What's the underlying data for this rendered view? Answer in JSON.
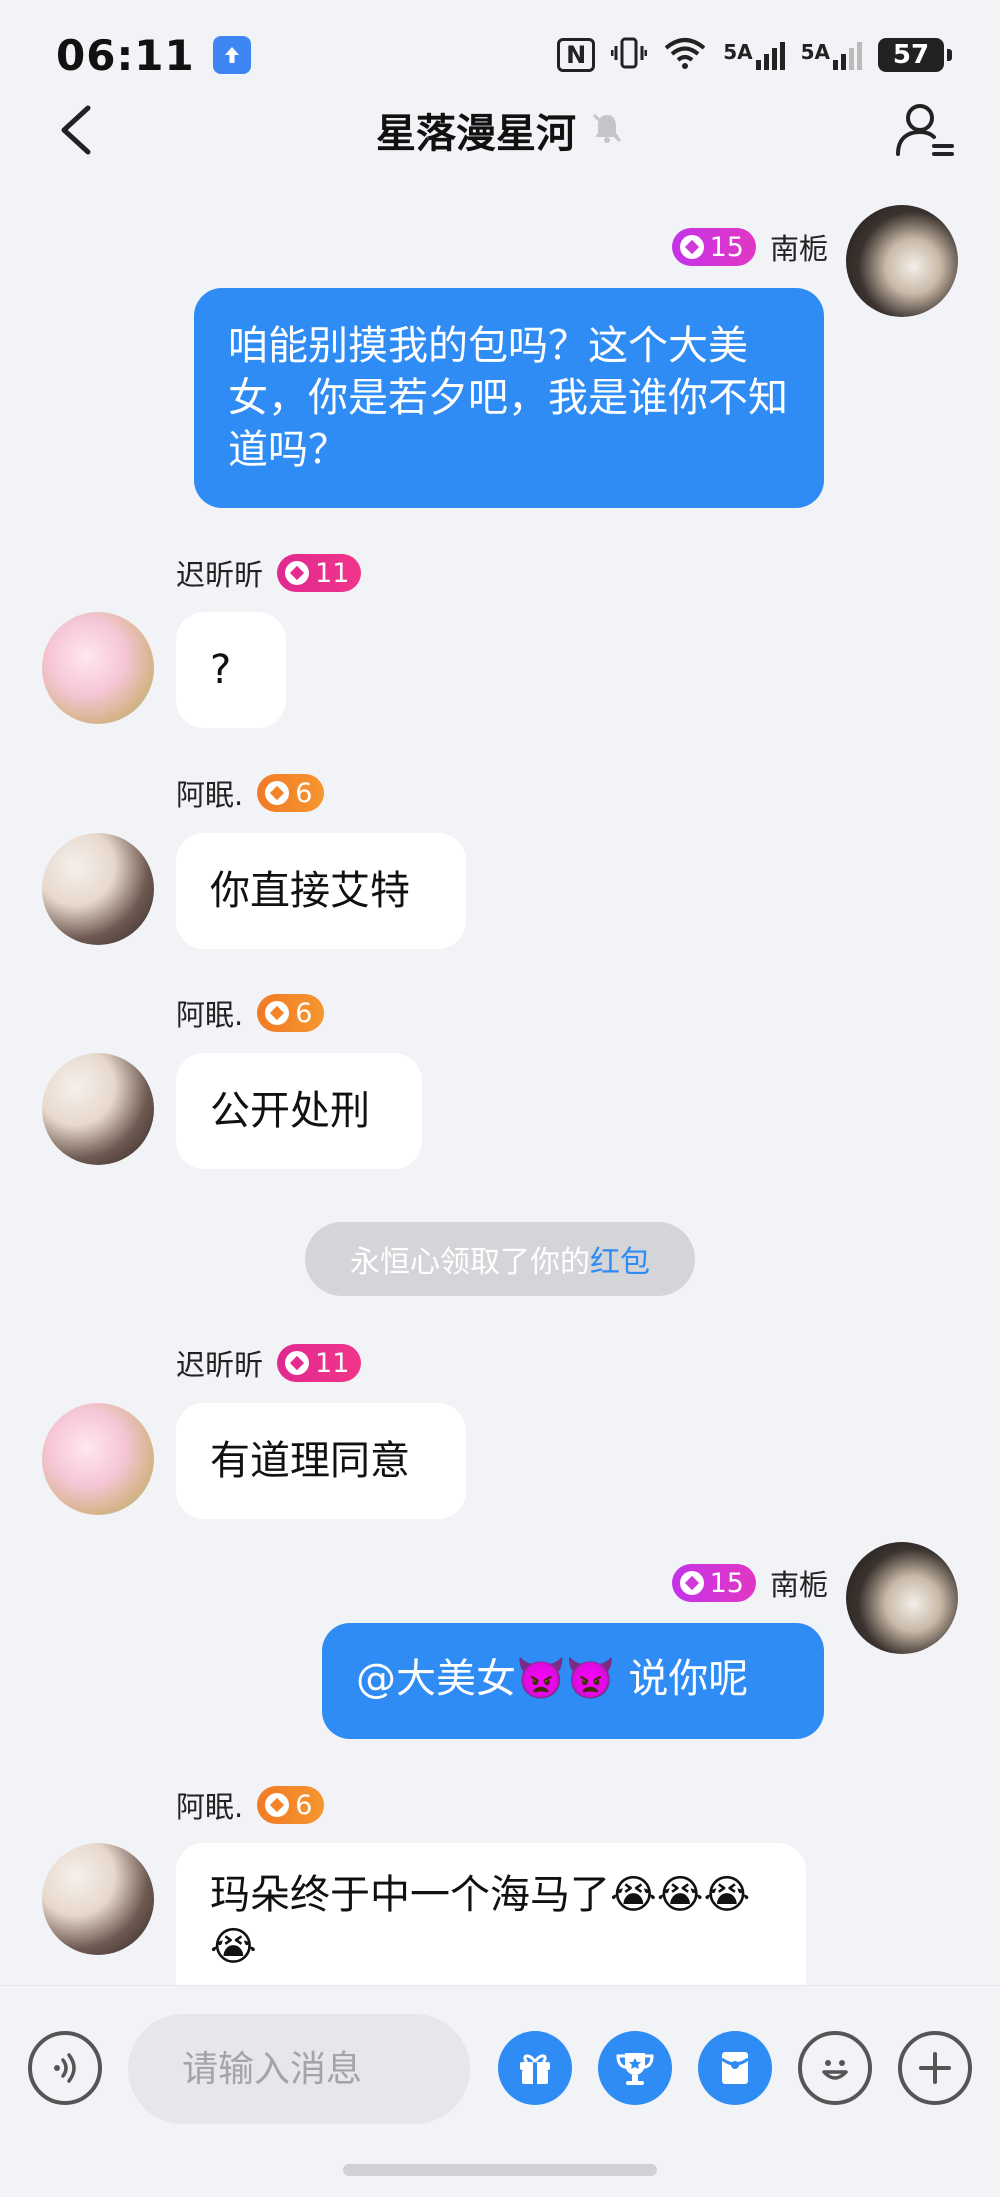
{
  "status_bar": {
    "time": "06:11",
    "nfc": "N",
    "signal_1": "5A",
    "signal_2": "5A",
    "battery": "57"
  },
  "header": {
    "title": "星落漫星河",
    "back_icon": "chevron-left-icon",
    "mute_icon": "bell-muted-icon",
    "members_icon": "group-members-icon"
  },
  "messages": [
    {
      "sender": "南栀",
      "level": "15",
      "badge_color": "#c334e8",
      "side": "right",
      "text": "咱能别摸我的包吗？这个大美女，你是若夕吧，我是谁你不知道吗？"
    },
    {
      "sender": "迟昕昕",
      "level": "11",
      "badge_color": "#e0298f",
      "side": "left",
      "text": "?"
    },
    {
      "sender": "阿眠.",
      "level": "6",
      "badge_color": "#f07a27",
      "side": "left",
      "text": "你直接艾特"
    },
    {
      "sender": "阿眠.",
      "level": "6",
      "badge_color": "#f07a27",
      "side": "left",
      "text": "公开处刑"
    },
    {
      "sender": "迟昕昕",
      "level": "11",
      "badge_color": "#e0298f",
      "side": "left",
      "text": "有道理同意"
    },
    {
      "sender": "南栀",
      "level": "15",
      "badge_color": "#c334e8",
      "side": "right",
      "text": "@大美女👿👿 说你呢"
    },
    {
      "sender": "阿眠.",
      "level": "6",
      "badge_color": "#f07a27",
      "side": "left",
      "text": "玛朵终于中一个海马了😭😭😭😭"
    }
  ],
  "system_notice": {
    "prefix": "永恒心领取了你的",
    "link": "红包"
  },
  "input_bar": {
    "placeholder": "请输入消息",
    "voice_icon": "voice-icon",
    "gift_icon": "gift-icon",
    "trophy_icon": "trophy-icon",
    "red_packet_icon": "red-packet-icon",
    "emoji_icon": "emoji-icon",
    "plus_icon": "plus-icon"
  },
  "colors": {
    "outgoing_bubble": "#2f8cf4",
    "incoming_bubble": "#ffffff",
    "background": "#f2f3f7"
  }
}
